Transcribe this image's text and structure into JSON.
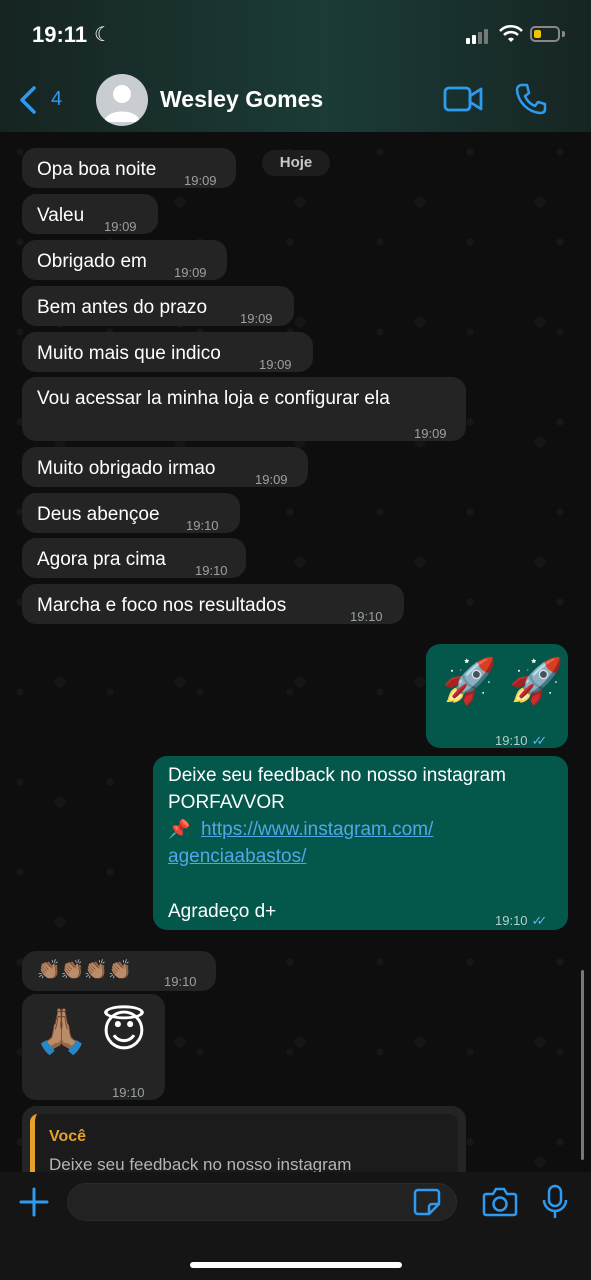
{
  "status_bar": {
    "time": "19:11"
  },
  "header": {
    "back_count": "4",
    "contact_name": "Wesley Gomes"
  },
  "date_label": "Hoje",
  "messages": [
    {
      "text": "Opa boa noite",
      "time": "19:09"
    },
    {
      "text": "Valeu",
      "time": "19:09"
    },
    {
      "text": "Obrigado em",
      "time": "19:09"
    },
    {
      "text": "Bem antes do prazo",
      "time": "19:09"
    },
    {
      "text": "Muito mais que indico",
      "time": "19:09"
    },
    {
      "text": "Vou acessar la minha loja e configurar ela",
      "time": "19:09"
    },
    {
      "text": "Muito obrigado irmao",
      "time": "19:09"
    },
    {
      "text": "Deus abençoe",
      "time": "19:10"
    },
    {
      "text": "Agora pra cima",
      "time": "19:10"
    },
    {
      "text": "Marcha e foco nos resultados",
      "time": "19:10"
    },
    {
      "text": "🚀 🚀",
      "time": "19:10"
    },
    {
      "line1": "Deixe seu feedback no nosso instagram",
      "line2": "PORFAVVOR",
      "pin": "📌",
      "link1": "https://www.instagram.com/",
      "link2": "agenciaabastos/",
      "line5": "Agradeço d+",
      "time": "19:10"
    },
    {
      "text": "👏🏽👏🏽👏🏽👏🏽",
      "time": "19:10"
    },
    {
      "text": "🙏🏽 😇",
      "time": "19:10"
    },
    {
      "quote_author": "Você",
      "quote_text": "Deixe seu feedback no nosso instagram"
    }
  ],
  "composer": {
    "placeholder": ""
  },
  "colors": {
    "incoming": "#242424",
    "outgoing": "#04574b",
    "accent": "#2e9bf0",
    "link": "#53a6e6"
  }
}
